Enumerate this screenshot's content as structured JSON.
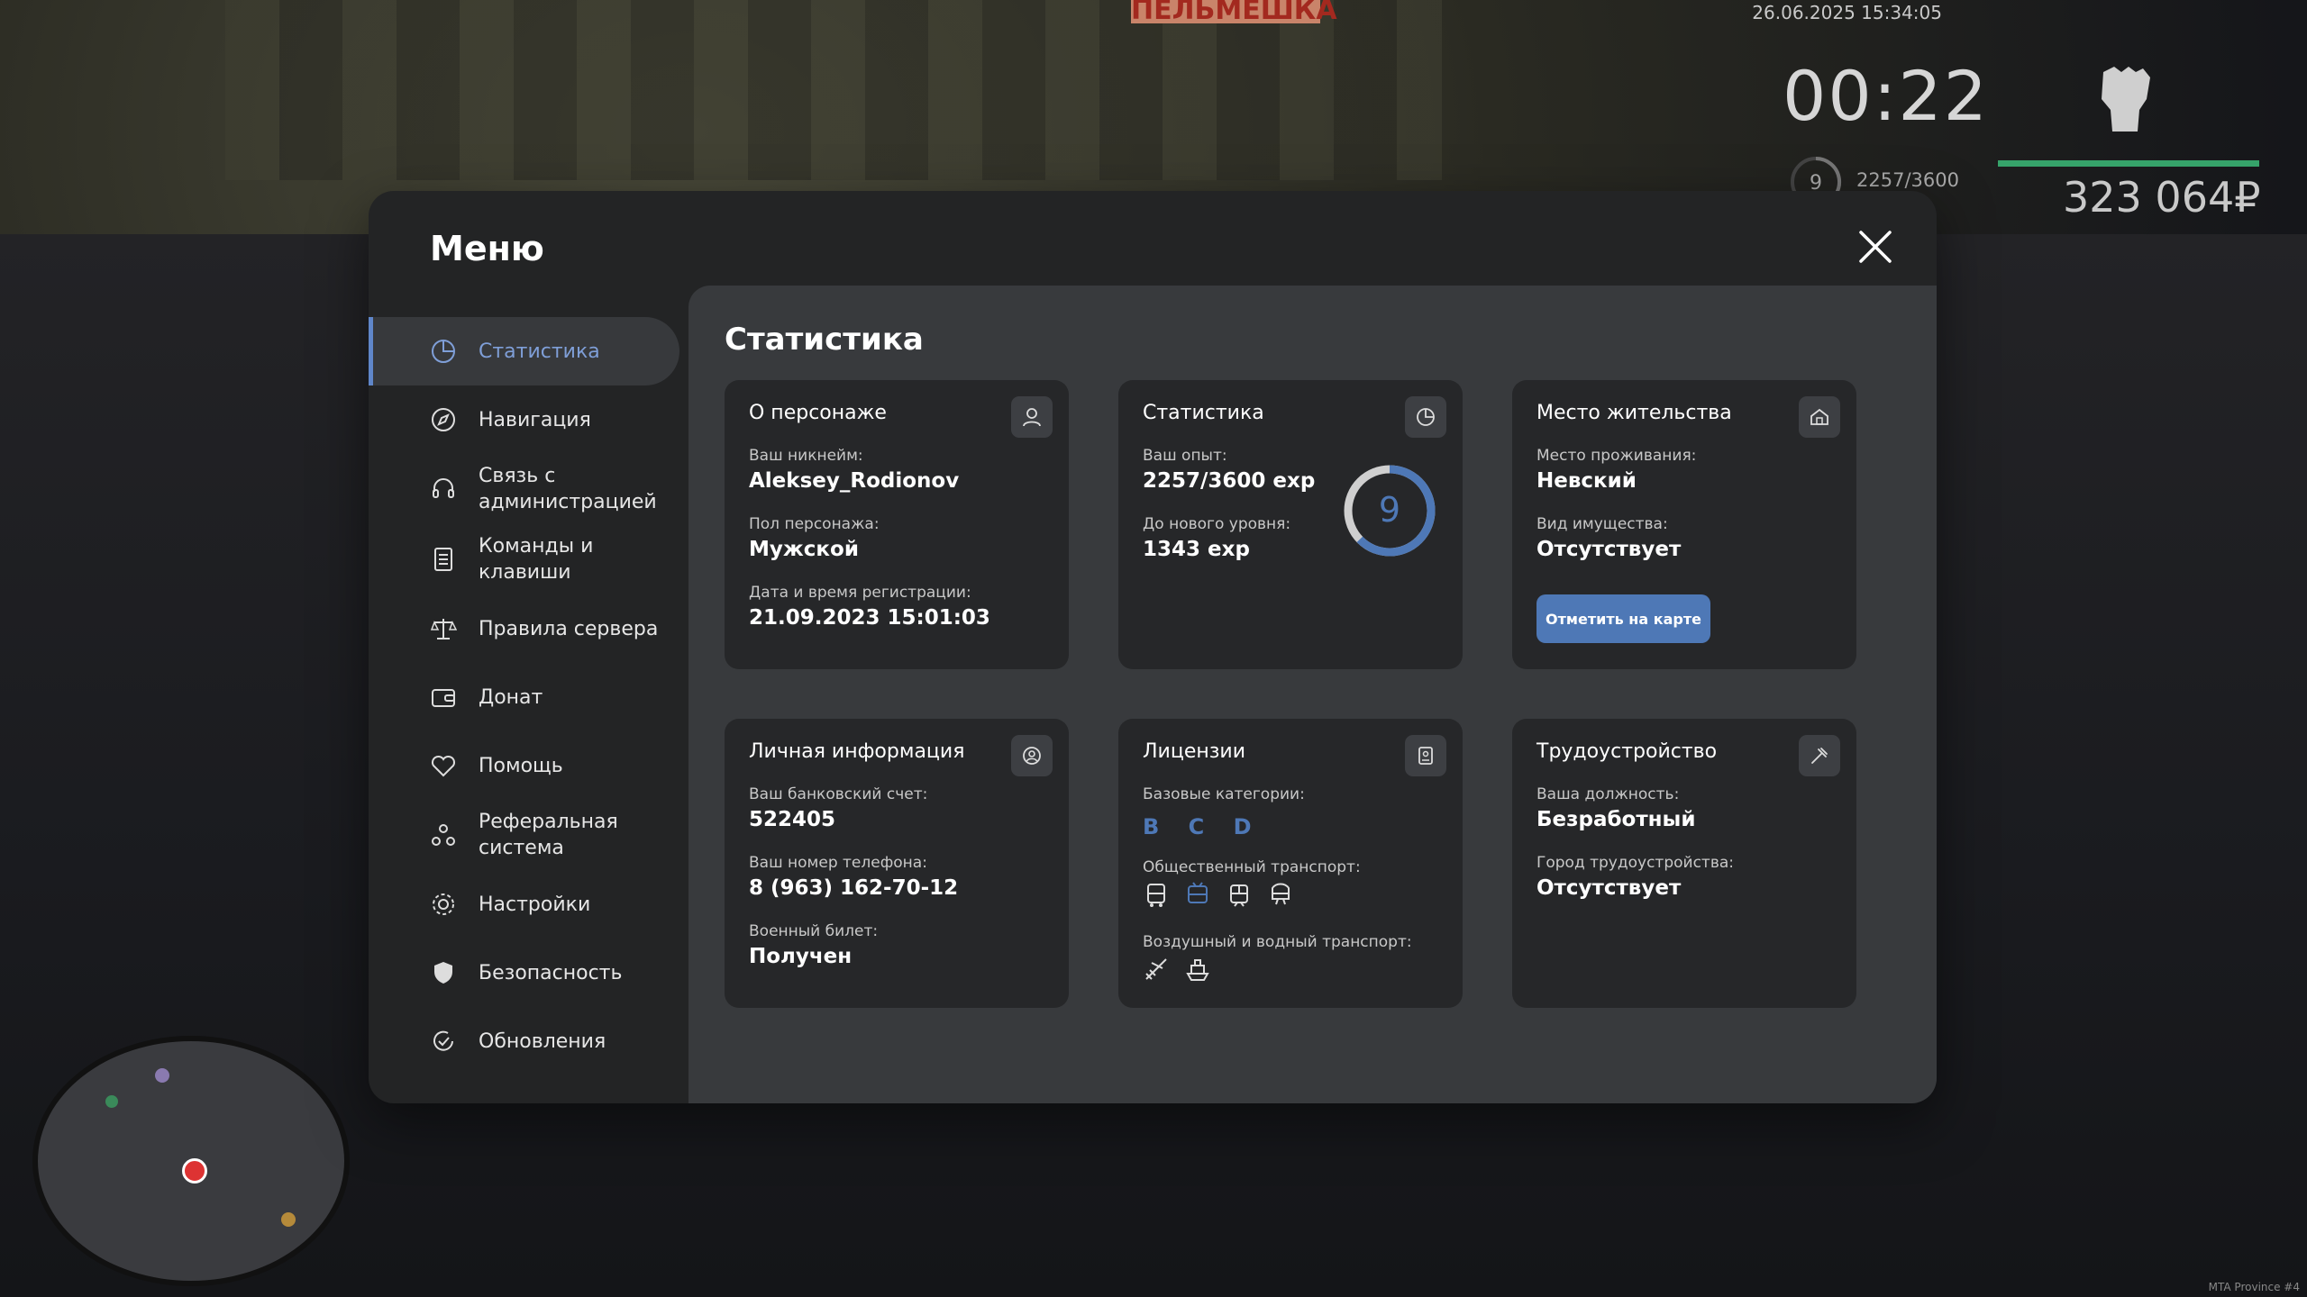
{
  "hud": {
    "datetime": "26.06.2025 15:34:05",
    "clock": "00:22",
    "level": "9",
    "exp": "2257/3600",
    "money": "323 064₽",
    "sign_text": "ПЕЛЬМЕШКА",
    "watermark": "MTA Province #4"
  },
  "menu": {
    "title": "Меню",
    "sidebar": [
      {
        "label": "Статистика",
        "icon": "pie-chart-icon",
        "active": true
      },
      {
        "label": "Навигация",
        "icon": "compass-icon"
      },
      {
        "label": "Связь с администрацией",
        "icon": "headset-icon"
      },
      {
        "label": "Команды и клавиши",
        "icon": "document-icon"
      },
      {
        "label": "Правила сервера",
        "icon": "scales-icon"
      },
      {
        "label": "Донат",
        "icon": "wallet-icon"
      },
      {
        "label": "Помощь",
        "icon": "heart-hand-icon"
      },
      {
        "label": "Реферальная система",
        "icon": "referral-icon"
      },
      {
        "label": "Настройки",
        "icon": "gear-icon"
      },
      {
        "label": "Безопасность",
        "icon": "shield-icon"
      },
      {
        "label": "Обновления",
        "icon": "refresh-icon"
      }
    ]
  },
  "content": {
    "title": "Статистика",
    "character": {
      "header": "О персонаже",
      "nick_label": "Ваш никнейм:",
      "nick": "Aleksey_Rodionov",
      "gender_label": "Пол персонажа:",
      "gender": "Мужской",
      "reg_label": "Дата и время регистрации:",
      "reg": "21.09.2023 15:01:03"
    },
    "stats": {
      "header": "Статистика",
      "exp_label": "Ваш опыт:",
      "exp": "2257/3600 exp",
      "next_label": "До нового уровня:",
      "next": "1343 exp",
      "level": "9",
      "progress": 0.627
    },
    "residence": {
      "header": "Место жительства",
      "place_label": "Место проживания:",
      "place": "Невский",
      "property_label": "Вид имущества:",
      "property": "Отсутствует",
      "button": "Отметить на карте"
    },
    "personal": {
      "header": "Личная информация",
      "bank_label": "Ваш банковский счет:",
      "bank": "522405",
      "phone_label": "Ваш номер телефона:",
      "phone": "8 (963) 162-70-12",
      "military_label": "Военный билет:",
      "military": "Получен"
    },
    "licenses": {
      "header": "Лицензии",
      "base_label": "Базовые категории:",
      "base": "B C D",
      "public_label": "Общественный транспорт:",
      "air_label": "Воздушный и водный транспорт:"
    },
    "job": {
      "header": "Трудоустройство",
      "position_label": "Ваша должность:",
      "position": "Безработный",
      "city_label": "Город трудоустройства:",
      "city": "Отсутствует"
    }
  },
  "colors": {
    "accent": "#4e78b6",
    "panel": "#262729",
    "content": "#383a3d",
    "menu": "#232425"
  }
}
